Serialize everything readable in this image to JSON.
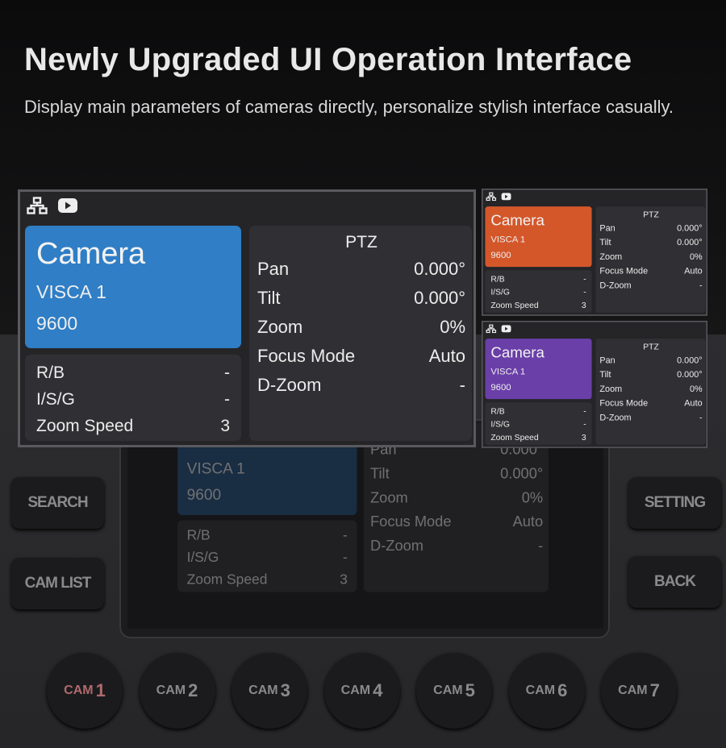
{
  "header": {
    "title": "Newly Upgraded UI Operation Interface",
    "subtitle": "Display main parameters of cameras directly, personalize stylish interface casually."
  },
  "panels": [
    {
      "accent": "#2f7ec6",
      "camera": "Camera",
      "protocol": "VISCA 1",
      "baud": "9600",
      "left": [
        {
          "label": "R/B",
          "value": "-"
        },
        {
          "label": "I/S/G",
          "value": "-"
        },
        {
          "label": "Zoom Speed",
          "value": "3"
        }
      ],
      "ptz_title": "PTZ",
      "ptz": [
        {
          "label": "Pan",
          "value": "0.000°"
        },
        {
          "label": "Tilt",
          "value": "0.000°"
        },
        {
          "label": "Zoom",
          "value": "0%"
        },
        {
          "label": "Focus Mode",
          "value": "Auto"
        },
        {
          "label": "D-Zoom",
          "value": "-"
        }
      ]
    },
    {
      "accent": "#d4572a",
      "camera": "Camera",
      "protocol": "VISCA 1",
      "baud": "9600",
      "left": [
        {
          "label": "R/B",
          "value": "-"
        },
        {
          "label": "I/S/G",
          "value": "-"
        },
        {
          "label": "Zoom Speed",
          "value": "3"
        }
      ],
      "ptz_title": "PTZ",
      "ptz": [
        {
          "label": "Pan",
          "value": "0.000°"
        },
        {
          "label": "Tilt",
          "value": "0.000°"
        },
        {
          "label": "Zoom",
          "value": "0%"
        },
        {
          "label": "Focus Mode",
          "value": "Auto"
        },
        {
          "label": "D-Zoom",
          "value": "-"
        }
      ]
    },
    {
      "accent": "#6a3fa8",
      "camera": "Camera",
      "protocol": "VISCA 1",
      "baud": "9600",
      "left": [
        {
          "label": "R/B",
          "value": "-"
        },
        {
          "label": "I/S/G",
          "value": "-"
        },
        {
          "label": "Zoom Speed",
          "value": "3"
        }
      ],
      "ptz_title": "PTZ",
      "ptz": [
        {
          "label": "Pan",
          "value": "0.000°"
        },
        {
          "label": "Tilt",
          "value": "0.000°"
        },
        {
          "label": "Zoom",
          "value": "0%"
        },
        {
          "label": "Focus Mode",
          "value": "Auto"
        },
        {
          "label": "D-Zoom",
          "value": "-"
        }
      ]
    }
  ],
  "header_icons": [
    "network-icon",
    "video-icon"
  ],
  "device": {
    "left_buttons": [
      "SEARCH",
      "CAM LIST"
    ],
    "right_buttons": [
      "SETTING",
      "BACK"
    ],
    "cam_buttons": [
      {
        "prefix": "CAM",
        "num": "1",
        "active": true
      },
      {
        "prefix": "CAM",
        "num": "2"
      },
      {
        "prefix": "CAM",
        "num": "3"
      },
      {
        "prefix": "CAM",
        "num": "4"
      },
      {
        "prefix": "CAM",
        "num": "5"
      },
      {
        "prefix": "CAM",
        "num": "6"
      },
      {
        "prefix": "CAM",
        "num": "7"
      }
    ],
    "active_cam_color": "#b06a6e"
  }
}
